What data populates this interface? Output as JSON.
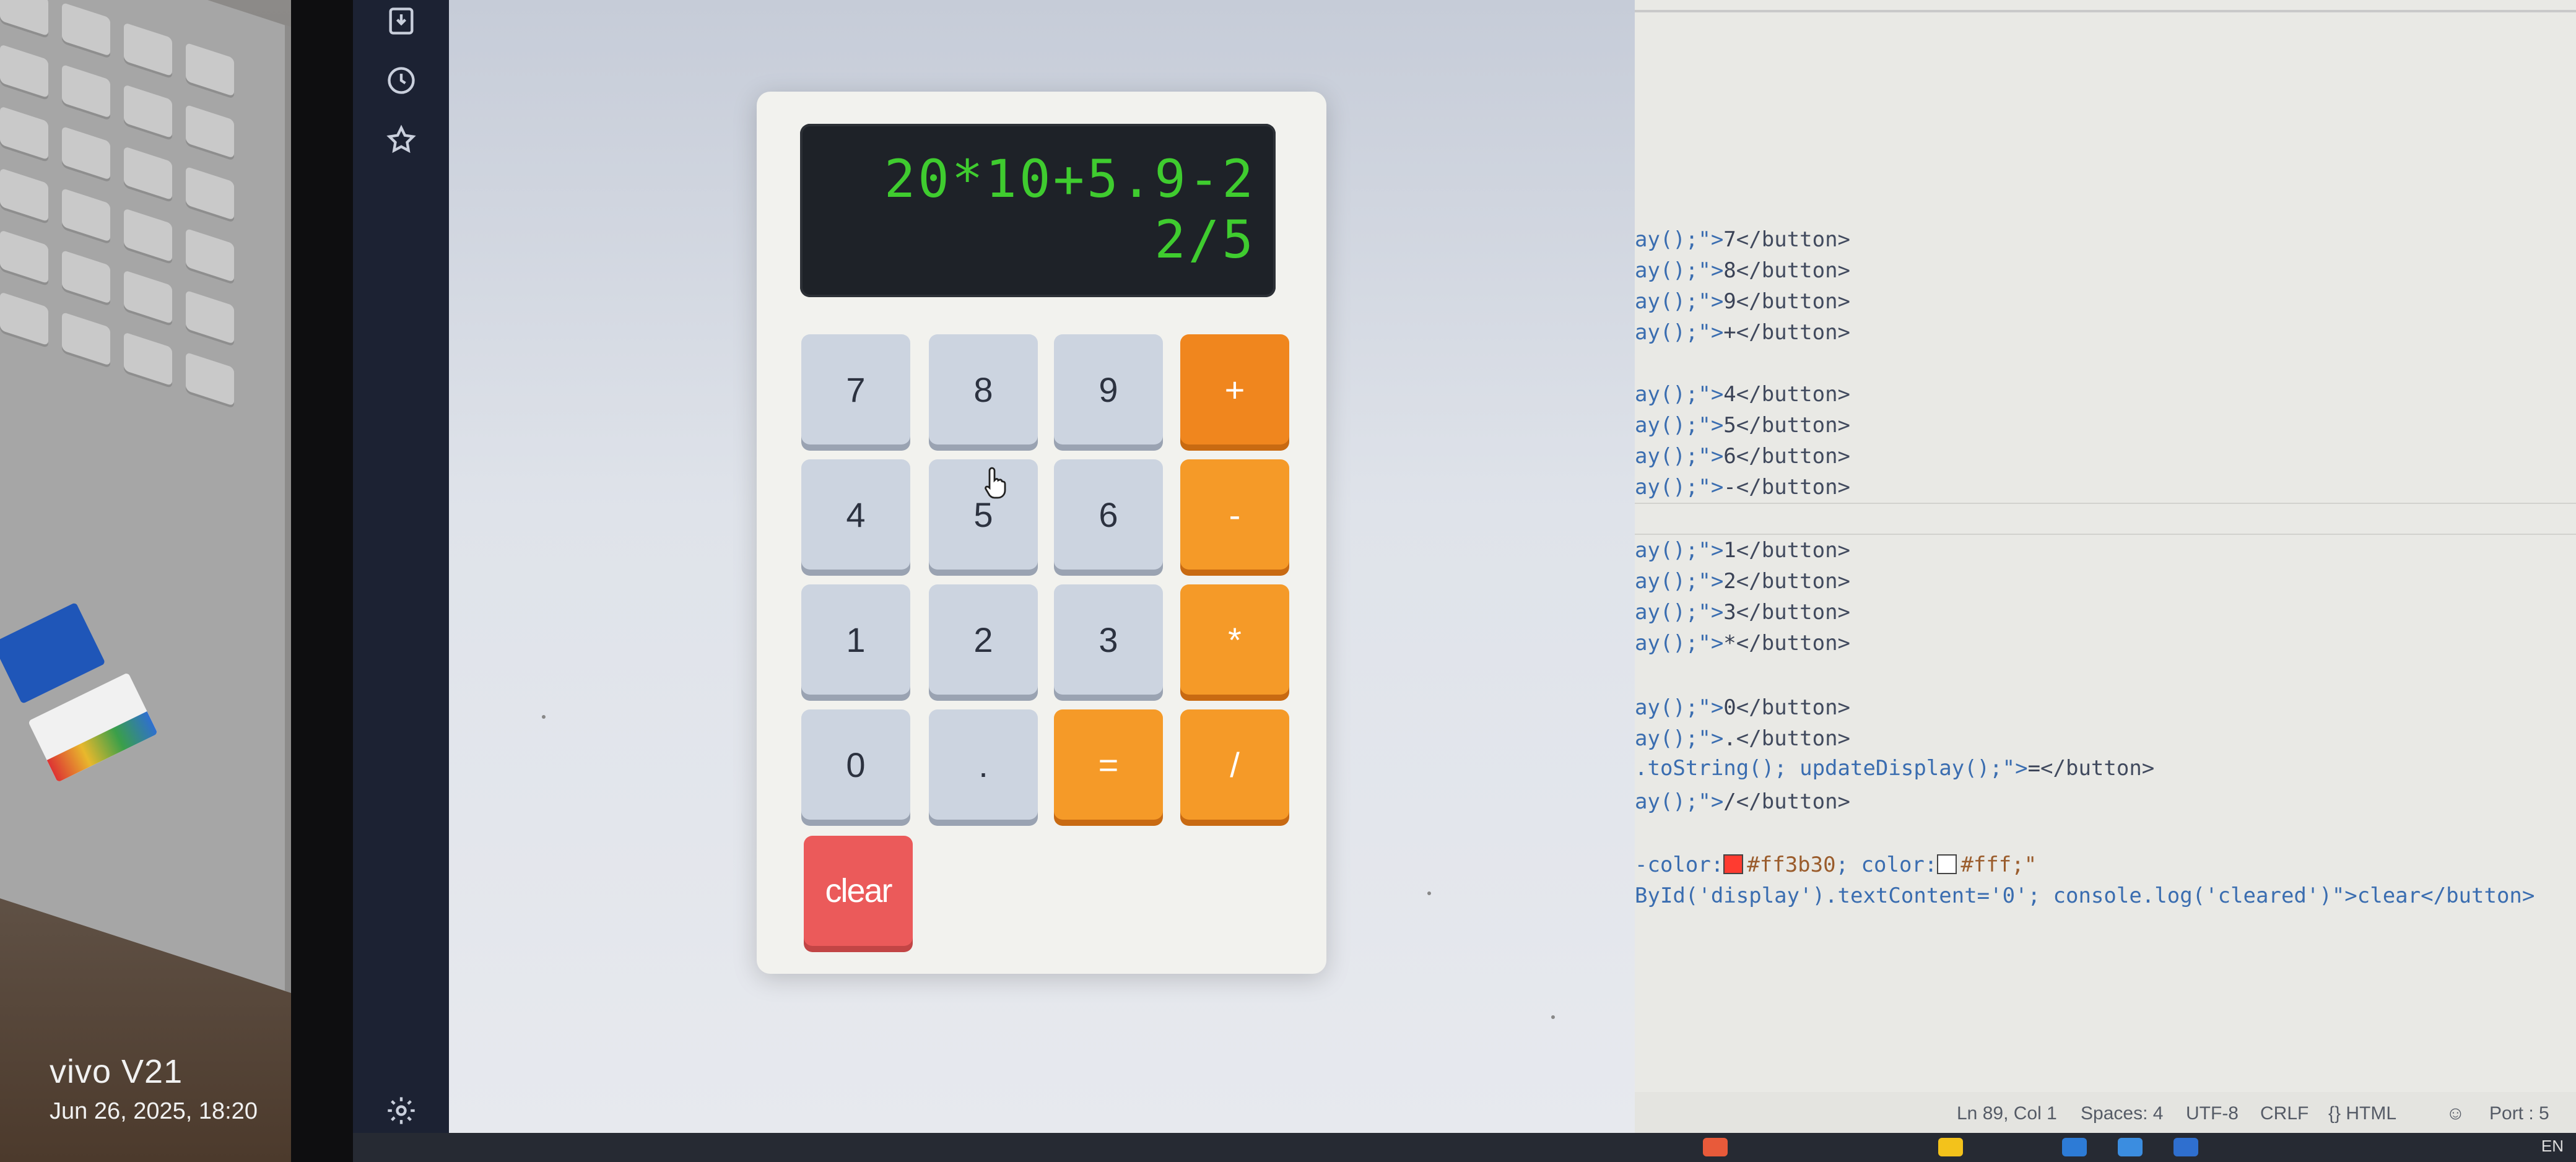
{
  "camera": {
    "model": "vivo V21",
    "datetime": "Jun 26, 2025, 18:20"
  },
  "activity_bar": {
    "icons": [
      "save-download-icon",
      "history-clock-icon",
      "star-icon",
      "settings-gear-icon"
    ]
  },
  "calculator": {
    "display": "20*10+5.9-22/5",
    "rows": [
      [
        "7",
        "8",
        "9",
        "+"
      ],
      [
        "4",
        "5",
        "6",
        "-"
      ],
      [
        "1",
        "2",
        "3",
        "*"
      ],
      [
        "0",
        ".",
        "=",
        "/"
      ]
    ],
    "clear_label": "clear",
    "colors": {
      "number_button": "#ccd4e0",
      "operator_button": "#f0861e",
      "clear_button": "#eb5a5a",
      "display_bg": "#1e2228",
      "display_text": "#3fcc2f"
    }
  },
  "editor": {
    "lines": [
      {
        "a": "ay();\">",
        "b": "7",
        "c": "</button>"
      },
      {
        "a": "ay();\">",
        "b": "8",
        "c": "</button>"
      },
      {
        "a": "ay();\">",
        "b": "9",
        "c": "</button>"
      },
      {
        "a": "ay();\">",
        "b": "+",
        "c": "</button>"
      },
      {
        "a": "ay();\">",
        "b": "4",
        "c": "</button>"
      },
      {
        "a": "ay();\">",
        "b": "5",
        "c": "</button>"
      },
      {
        "a": "ay();\">",
        "b": "6",
        "c": "</button>"
      },
      {
        "a": "ay();\">",
        "b": "-",
        "c": "</button>"
      },
      {
        "a": "ay();\">",
        "b": "1",
        "c": "</button>"
      },
      {
        "a": "ay();\">",
        "b": "2",
        "c": "</button>"
      },
      {
        "a": "ay();\">",
        "b": "3",
        "c": "</button>"
      },
      {
        "a": "ay();\">",
        "b": "*",
        "c": "</button>"
      },
      {
        "a": "ay();\">",
        "b": "0",
        "c": "</button>"
      },
      {
        "a": "ay();\">",
        "b": ".",
        "c": "</button>"
      },
      {
        "a": ".toString(); updateDisplay();\">",
        "b": "=",
        "c": "</button>"
      },
      {
        "a": "ay();\">",
        "b": "/",
        "c": "</button>"
      }
    ],
    "color_line": {
      "prefix": "-color:",
      "color1": "#ff3b30",
      "mid": "; color:",
      "color2": "#fff",
      "suffix": ";\""
    },
    "clear_line": "ById('display').textContent='0'; console.log('cleared')\">clear</button>"
  },
  "status_bar": {
    "position": "Ln 89, Col 1",
    "spaces": "Spaces: 4",
    "encoding": "UTF-8",
    "eol": "CRLF",
    "language": "{} HTML",
    "port": "Port : 5"
  },
  "taskbar": {
    "lang": "EN"
  }
}
